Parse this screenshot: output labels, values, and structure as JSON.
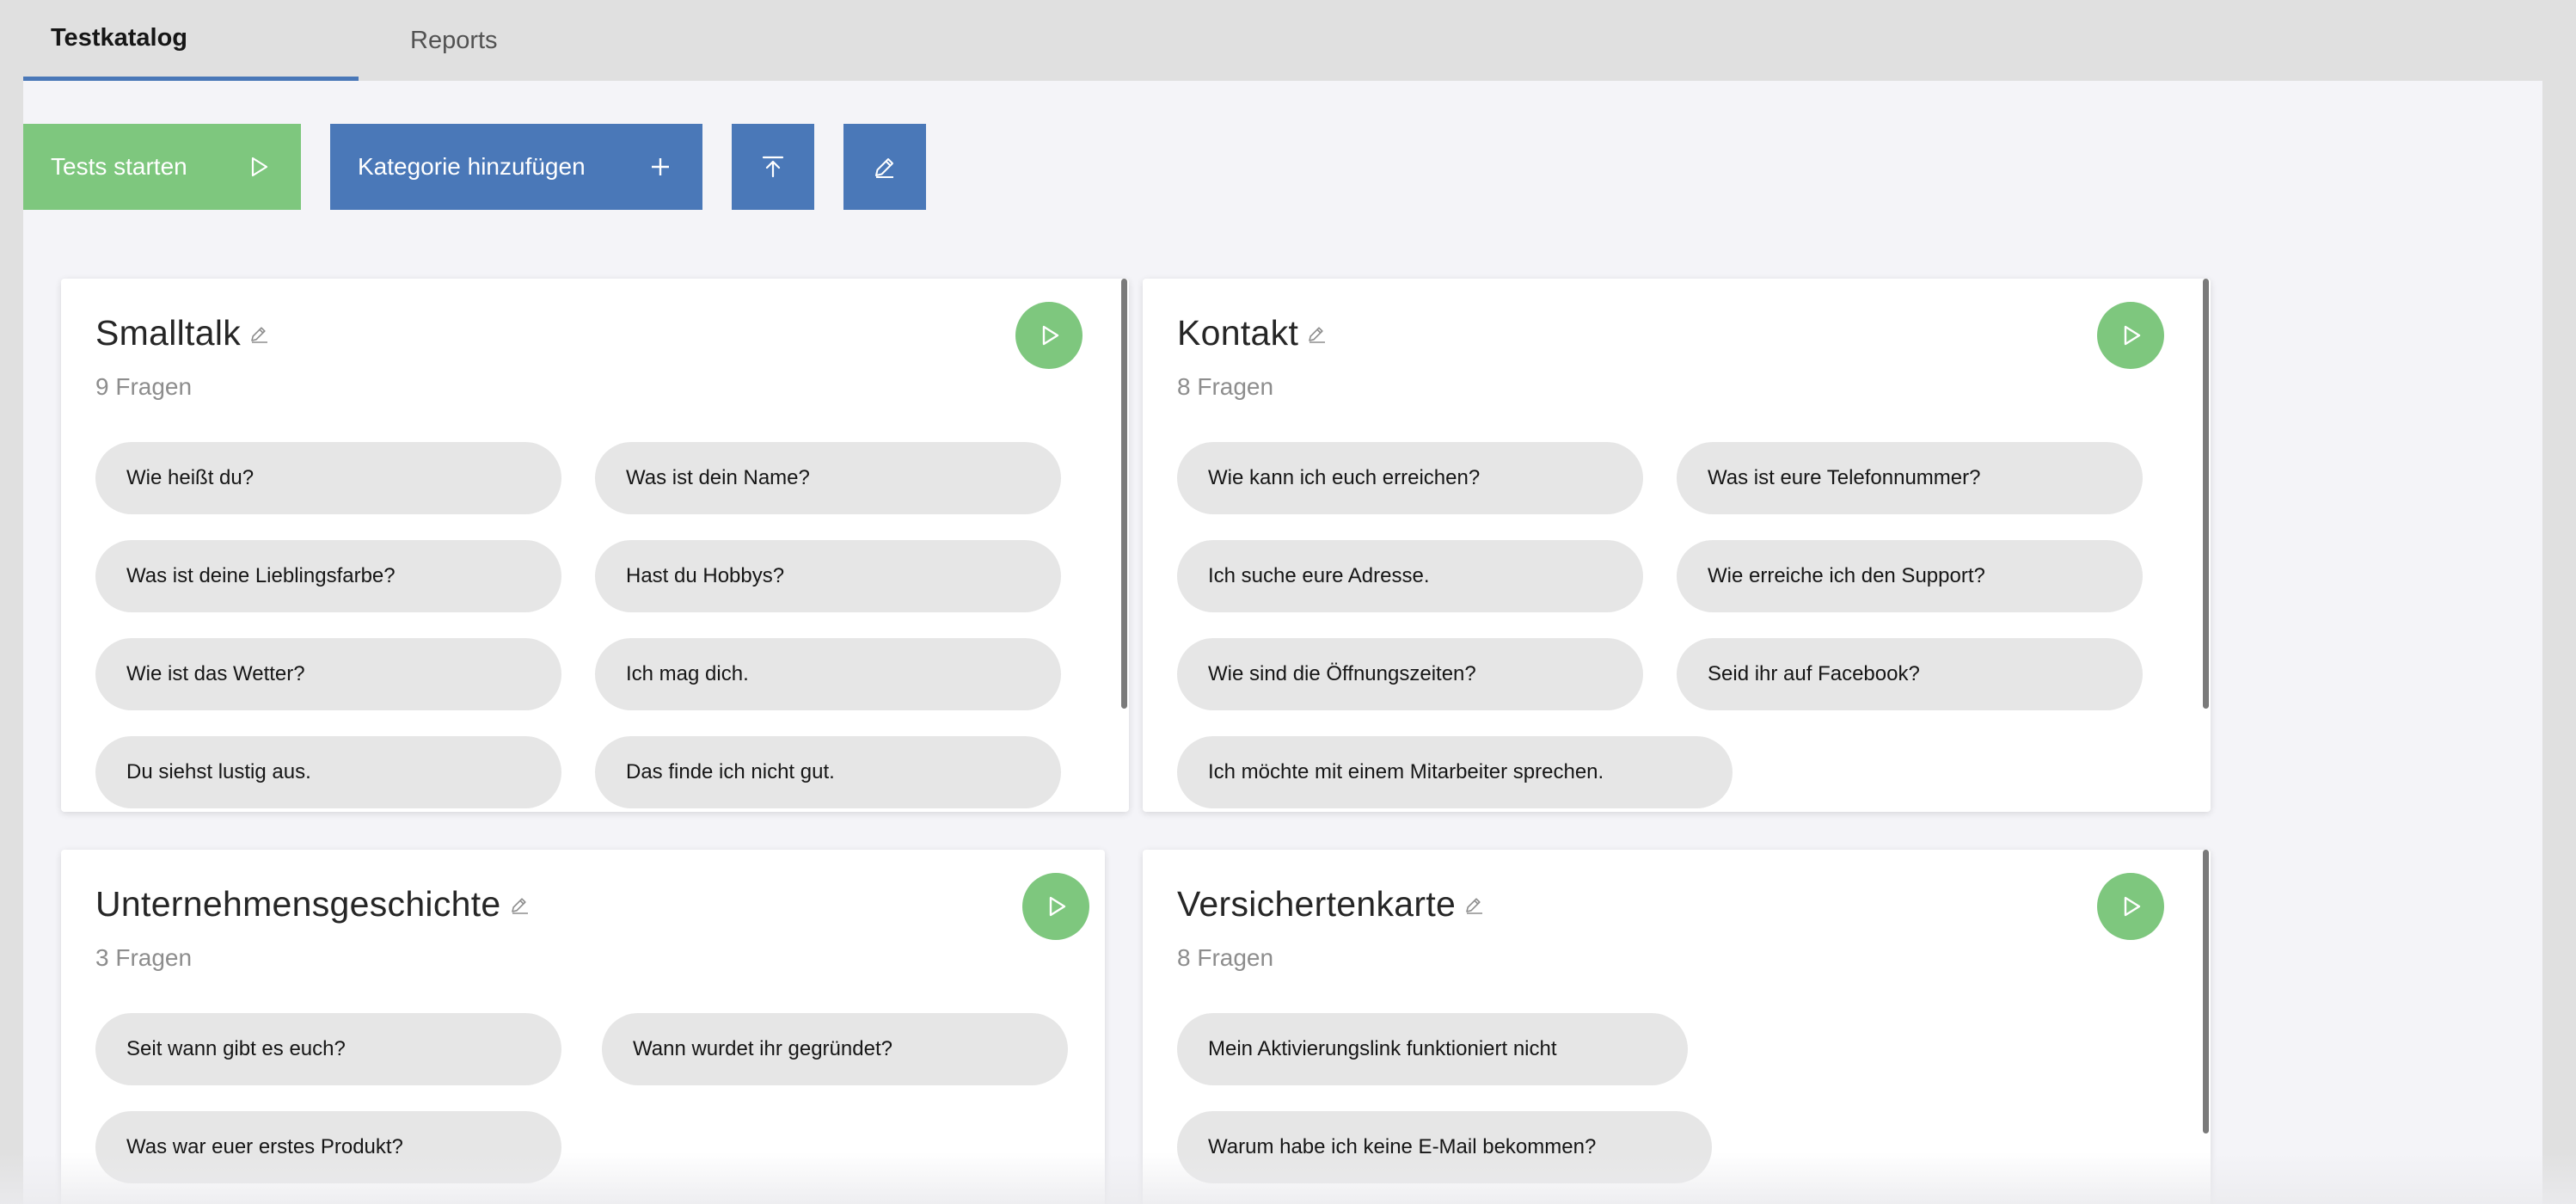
{
  "tabs": {
    "active": "Testkatalog",
    "reports": "Reports"
  },
  "toolbar": {
    "start_label": "Tests starten",
    "add_label": "Kategorie hinzufügen"
  },
  "colors": {
    "green": "#7ec77e",
    "blue": "#4a78b8",
    "pill": "#e6e6e6"
  },
  "cards": [
    {
      "title": "Smalltalk",
      "count": "9 Fragen",
      "questions": [
        "Wie heißt du?",
        "Was ist dein Name?",
        "Was ist deine Lieblingsfarbe?",
        "Hast du Hobbys?",
        "Wie ist das Wetter?",
        "Ich mag dich.",
        "Du siehst lustig aus.",
        "Das finde ich nicht gut."
      ]
    },
    {
      "title": "Kontakt",
      "count": "8 Fragen",
      "questions": [
        "Wie kann ich euch erreichen?",
        "Was ist eure Telefonnummer?",
        "Ich suche eure Adresse.",
        "Wie erreiche ich den Support?",
        "Wie sind die Öffnungszeiten?",
        "Seid ihr auf Facebook?",
        "Ich möchte mit einem Mitarbeiter sprechen."
      ]
    },
    {
      "title": "Unternehmensgeschichte",
      "count": "3 Fragen",
      "questions": [
        "Seit wann gibt es euch?",
        "Wann wurdet ihr gegründet?",
        "Was war euer erstes Produkt?"
      ]
    },
    {
      "title": "Versichertenkarte",
      "count": "8 Fragen",
      "questions": [
        "Mein Aktivierungslink funktioniert nicht",
        "Warum habe ich keine E-Mail bekommen?"
      ]
    }
  ]
}
